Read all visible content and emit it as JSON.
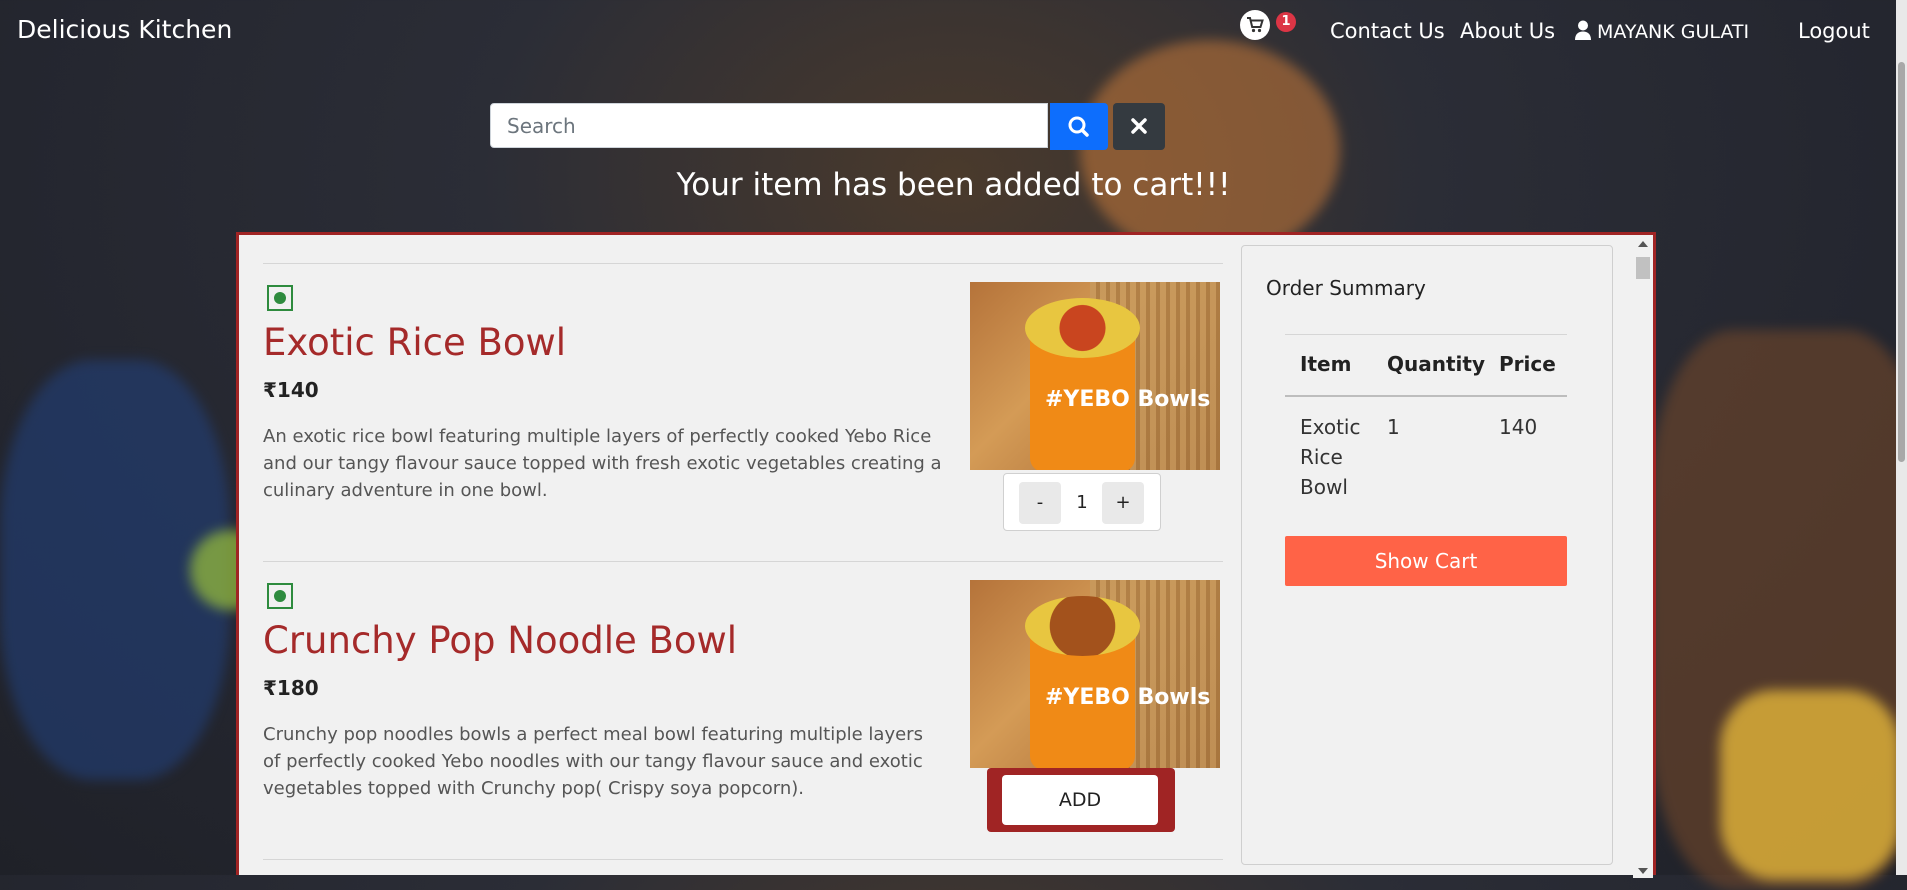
{
  "navbar": {
    "brand": "Delicious Kitchen",
    "cart_count": "1",
    "contact": "Contact Us",
    "about": "About Us",
    "user_name": "MAYANK GULATI",
    "logout": "Logout"
  },
  "search": {
    "placeholder": "Search"
  },
  "message": "Your item has been added to cart!!!",
  "menu": {
    "items": [
      {
        "name": "Exotic Rice Bowl",
        "price": "₹140",
        "description": "An exotic rice bowl featuring multiple layers of perfectly cooked Yebo Rice and our tangy flavour sauce topped with fresh exotic vegetables creating a culinary adventure in one bowl.",
        "quantity": "1",
        "minus": "-",
        "plus": "+",
        "image_text": "#YEBO Bowls"
      },
      {
        "name": "Crunchy Pop Noodle Bowl",
        "price": "₹180",
        "description": "Crunchy pop noodles bowls a perfect meal bowl featuring multiple layers of perfectly cooked Yebo noodles with our tangy flavour sauce and exotic vegetables topped with Crunchy pop( Crispy soya popcorn).",
        "add_label": "ADD",
        "image_text": "#YEBO Bowls"
      }
    ]
  },
  "summary": {
    "title": "Order Summary",
    "headers": [
      "Item",
      "Quantity",
      "Price"
    ],
    "rows": [
      {
        "item": "Exotic Rice Bowl",
        "quantity": "1",
        "price": "140"
      }
    ],
    "show_cart": "Show Cart"
  },
  "colors": {
    "accent_red": "#a02424",
    "title_red": "#a52a2a",
    "tomato": "#ff6347",
    "search_blue": "#0d6efd",
    "veg_green": "#2e8b3e"
  }
}
